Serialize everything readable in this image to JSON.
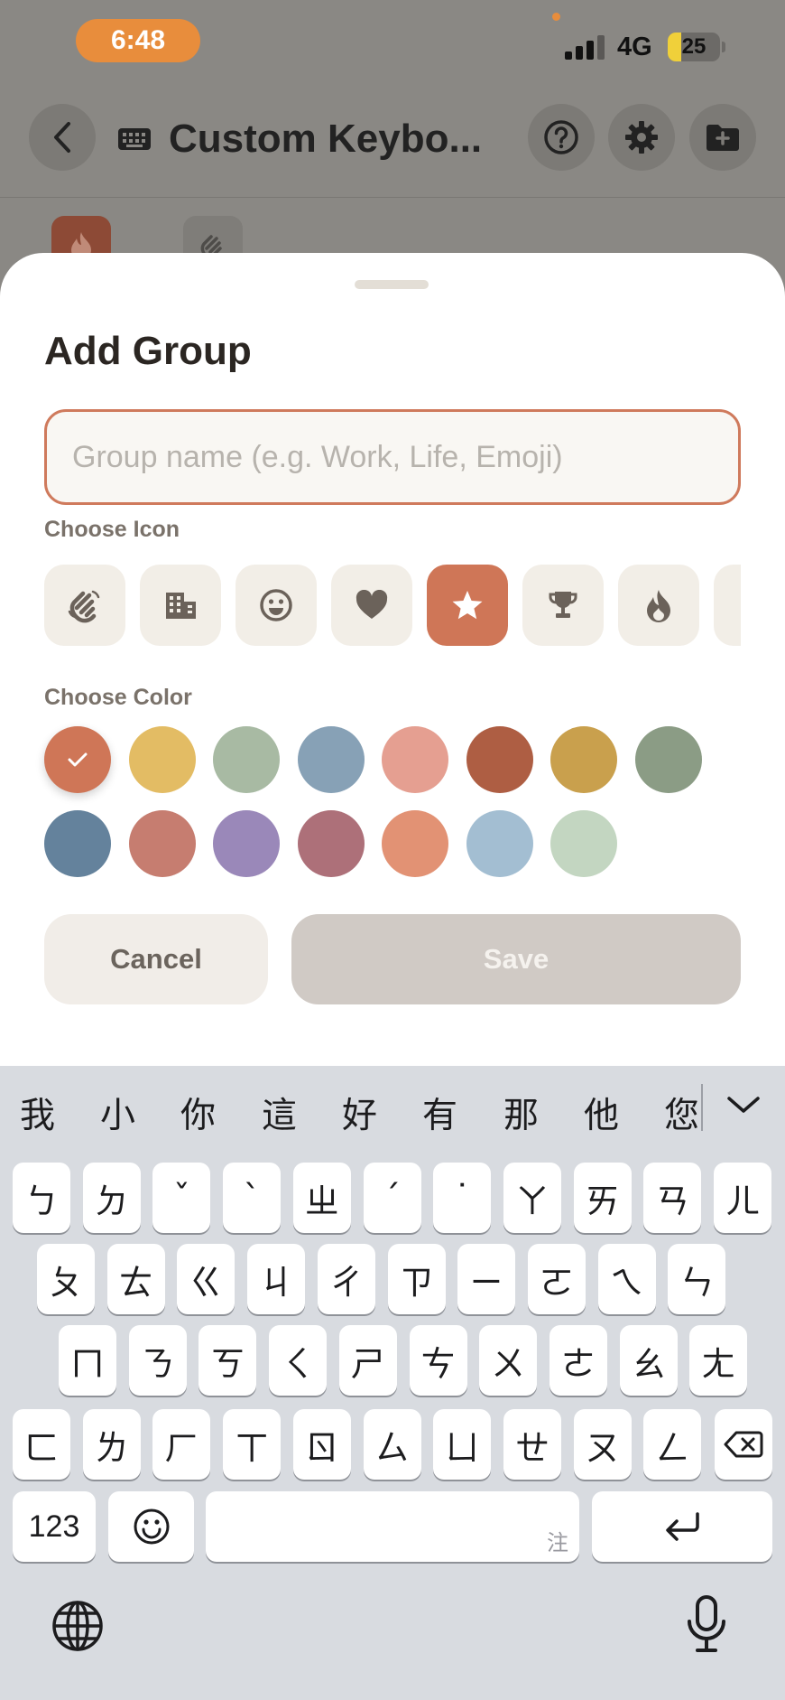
{
  "status_bar": {
    "time": "6:48",
    "network": "4G",
    "battery_level": 25,
    "battery_text": "25"
  },
  "background_app": {
    "title": "Custom Keybo...",
    "icons": [
      "back-chevron-icon",
      "keyboard-icon",
      "help-circle-icon",
      "gear-icon",
      "folder-plus-icon"
    ],
    "visible_group_chips": [
      "fire-icon",
      "waving-hand-icon"
    ]
  },
  "sheet": {
    "title": "Add Group",
    "input": {
      "value": "",
      "placeholder": "Group name (e.g. Work, Life, Emoji)"
    },
    "icon_section_label": "Choose Icon",
    "icons": [
      {
        "name": "waving-hand-icon",
        "selected": false
      },
      {
        "name": "building-icon",
        "selected": false
      },
      {
        "name": "smiley-icon",
        "selected": false
      },
      {
        "name": "heart-icon",
        "selected": false
      },
      {
        "name": "star-icon",
        "selected": true
      },
      {
        "name": "trophy-icon",
        "selected": false
      },
      {
        "name": "fire-icon",
        "selected": false
      }
    ],
    "color_section_label": "Choose Color",
    "colors": [
      {
        "hex": "#CF7657",
        "selected": true
      },
      {
        "hex": "#E3BC64",
        "selected": false
      },
      {
        "hex": "#A8BAA3",
        "selected": false
      },
      {
        "hex": "#87A1B6",
        "selected": false
      },
      {
        "hex": "#E59F91",
        "selected": false
      },
      {
        "hex": "#AE5E43",
        "selected": false
      },
      {
        "hex": "#C9A04D",
        "selected": false
      },
      {
        "hex": "#8B9C85",
        "selected": false
      },
      {
        "hex": "#64829C",
        "selected": false
      },
      {
        "hex": "#C67D70",
        "selected": false
      },
      {
        "hex": "#9A88B9",
        "selected": false
      },
      {
        "hex": "#AD7079",
        "selected": false
      },
      {
        "hex": "#E29274",
        "selected": false
      },
      {
        "hex": "#A3BED2",
        "selected": false
      },
      {
        "hex": "#C3D6C1",
        "selected": false
      }
    ],
    "cancel_label": "Cancel",
    "save_label": "Save"
  },
  "keyboard": {
    "candidates": [
      "我",
      "小",
      "你",
      "這",
      "好",
      "有",
      "那",
      "他",
      "您"
    ],
    "rows": [
      [
        "ㄅ",
        "ㄉ",
        "ˇ",
        "ˋ",
        "ㄓ",
        "ˊ",
        "˙",
        "ㄚ",
        "ㄞ",
        "ㄢ",
        "ㄦ"
      ],
      [
        "ㄆ",
        "ㄊ",
        "ㄍ",
        "ㄐ",
        "ㄔ",
        "ㄗ",
        "ㄧ",
        "ㄛ",
        "ㄟ",
        "ㄣ"
      ],
      [
        "ㄇ",
        "ㄋ",
        "ㄎ",
        "ㄑ",
        "ㄕ",
        "ㄘ",
        "ㄨ",
        "ㄜ",
        "ㄠ",
        "ㄤ"
      ],
      [
        "ㄈ",
        "ㄌ",
        "ㄏ",
        "ㄒ",
        "ㄖ",
        "ㄙ",
        "ㄩ",
        "ㄝ",
        "ㄡ",
        "ㄥ"
      ]
    ],
    "numbers_key": "123",
    "space_hint": "注"
  }
}
